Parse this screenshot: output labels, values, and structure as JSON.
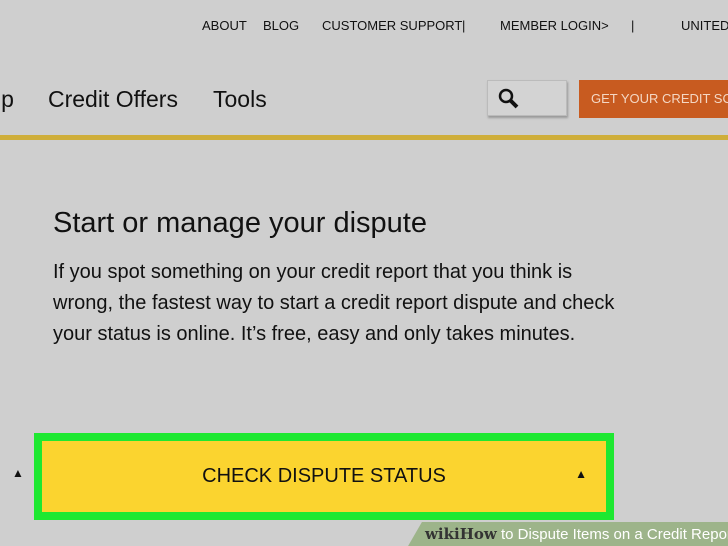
{
  "top_links": [
    "ABOUT",
    "BLOG",
    "CUSTOMER SUPPORT",
    "|",
    "MEMBER LOGIN>",
    "|",
    "UNITED"
  ],
  "nav": [
    "lp",
    "Credit Offers",
    "Tools"
  ],
  "cta": "GET YOUR CREDIT SCORE",
  "heading": "Start or manage your dispute",
  "body": "If you spot something on your credit report that you think is wrong, the fastest way to start a credit report dispute and check your status is online. It’s free, easy and only takes minutes.",
  "button": "CHECK DISPUTE STATUS",
  "watermark": {
    "brand": "wikiHow",
    "title": "to Dispute Items on a Credit Report"
  }
}
